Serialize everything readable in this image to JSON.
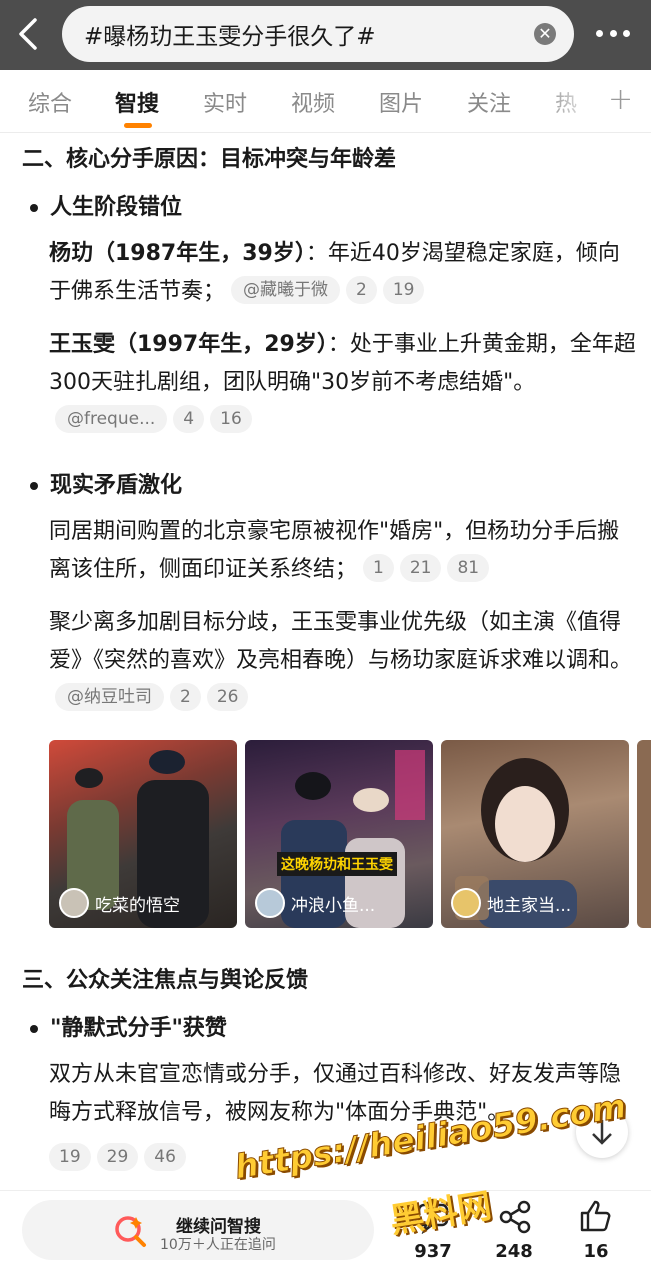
{
  "search": {
    "query": "#曝杨玏王玉雯分手很久了#"
  },
  "tabs": [
    "综合",
    "智搜",
    "实时",
    "视频",
    "图片",
    "关注",
    "热"
  ],
  "sections": {
    "s2_title": "二、核心分手原因：目标冲突与年龄差",
    "s2_b1": "人生阶段错位",
    "p1_bold": "杨玏（1987年生，39岁）",
    "p1_text": "：年近40岁渴望稳定家庭，倾向于佛系生活节奏；",
    "p1_user": "@藏曦于微",
    "p1_c1": "2",
    "p1_c2": "19",
    "p2_bold": "王玉雯（1997年生，29岁）",
    "p2_text": "：处于事业上升黄金期，全年超300天驻扎剧组，团队明确\"30岁前不考虑结婚\"。",
    "p2_user": "@freque...",
    "p2_c1": "4",
    "p2_c2": "16",
    "s2_b2": "现实矛盾激化",
    "p3_text": "同居期间购置的北京豪宅原被视作\"婚房\"，但杨玏分手后搬离该住所，侧面印证关系终结；",
    "p3_c1": "1",
    "p3_c2": "21",
    "p3_c3": "81",
    "p4_text": "聚少离多加剧目标分歧，王玉雯事业优先级（如主演《值得爱》《突然的喜欢》及亮相春晚）与杨玏家庭诉求难以调和。",
    "p4_user": "@纳豆吐司",
    "p4_c1": "2",
    "p4_c2": "26",
    "s3_title": "三、公众关注焦点与舆论反馈",
    "s3_b1": "\"静默式分手\"获赞",
    "p5_text": "双方从未官宣恋情或分手，仅通过百科修改、好友发声等隐晦方式释放信号，被网友称为\"体面分手典范\"。",
    "p5_c1": "19",
    "p5_c2": "29",
    "p5_c3": "46"
  },
  "images": [
    {
      "user": "吃菜的悟空"
    },
    {
      "user": "冲浪小鱼...",
      "overlay": "这晚杨玏和王玉雯"
    },
    {
      "user": "地主家当..."
    }
  ],
  "bottom": {
    "ask_title": "继续问智搜",
    "ask_sub": "10万＋人正在追问",
    "comments": "937",
    "shares": "248",
    "likes": "16"
  },
  "watermark": {
    "url": "https://heiliao59.com",
    "name": "黑料网"
  },
  "colors": {
    "accent": "#ff8200",
    "topbar": "#4d4d4d"
  }
}
